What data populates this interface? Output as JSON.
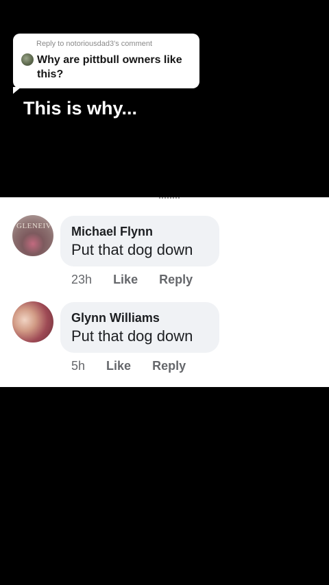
{
  "reply_card": {
    "header": "Reply to notoriousdad3's comment",
    "text": "Why are pittbull owners like this?"
  },
  "caption": "This is why...",
  "comments": [
    {
      "name": "Michael Flynn",
      "text": "Put that dog down",
      "time": "23h",
      "like_label": "Like",
      "reply_label": "Reply"
    },
    {
      "name": "Glynn Williams",
      "text": "Put that dog down",
      "time": "5h",
      "like_label": "Like",
      "reply_label": "Reply"
    }
  ]
}
